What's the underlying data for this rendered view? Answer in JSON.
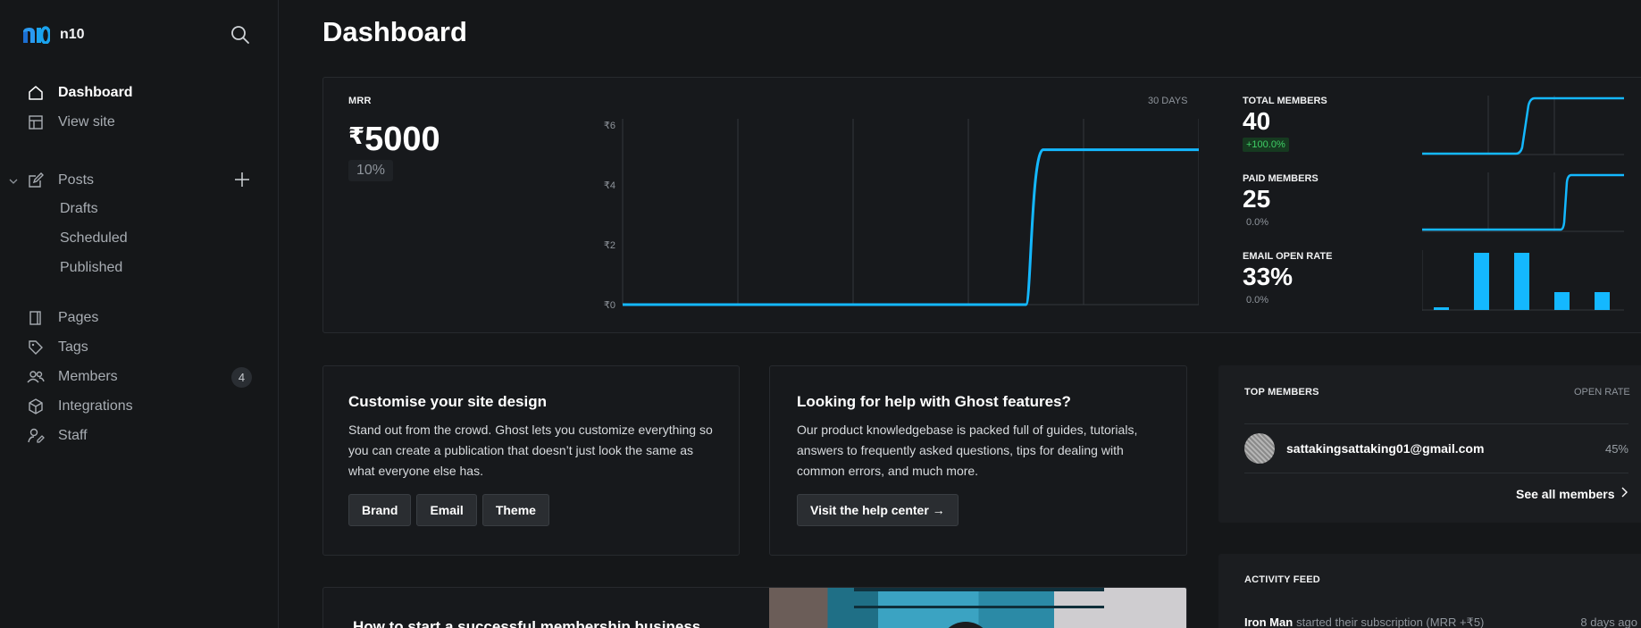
{
  "brand": {
    "name": "n10"
  },
  "sidebar": {
    "items": [
      {
        "label": "Dashboard",
        "icon": "home-icon"
      },
      {
        "label": "View site",
        "icon": "layout-icon"
      },
      {
        "label": "Posts",
        "icon": "edit-icon"
      },
      {
        "label": "Pages",
        "icon": "page-icon"
      },
      {
        "label": "Tags",
        "icon": "tag-icon"
      },
      {
        "label": "Members",
        "icon": "members-icon",
        "badge": "4"
      },
      {
        "label": "Integrations",
        "icon": "cube-icon"
      },
      {
        "label": "Staff",
        "icon": "staff-icon"
      }
    ],
    "posts_sub": [
      "Drafts",
      "Scheduled",
      "Published"
    ]
  },
  "main": {
    "title": "Dashboard"
  },
  "mrr": {
    "label": "MRR",
    "currency": "₹",
    "value": "5000",
    "change": "10%",
    "range": "30 DAYS"
  },
  "stats": [
    {
      "label": "TOTAL MEMBERS",
      "value": "40",
      "delta": "+100.0%"
    },
    {
      "label": "PAID MEMBERS",
      "value": "25",
      "delta": "0.0%"
    },
    {
      "label": "EMAIL OPEN RATE",
      "value": "33%",
      "delta": "0.0%"
    }
  ],
  "chart_data": {
    "type": "line",
    "x": [
      0,
      1,
      2,
      3,
      4,
      5
    ],
    "values": [
      0,
      0,
      0,
      0,
      5,
      5
    ],
    "tick_labels": [
      "₹0",
      "₹2",
      "₹4",
      "₹6"
    ],
    "ylim": [
      0,
      6
    ],
    "grid": true,
    "color": "#14b8ff"
  },
  "info_cards": [
    {
      "title": "Customise your site design",
      "body": "Stand out from the crowd. Ghost lets you customize everything so you can create a publication that doesn’t just look the same as what everyone else has.",
      "buttons": [
        "Brand",
        "Email",
        "Theme"
      ]
    },
    {
      "title": "Looking for help with Ghost features?",
      "body": "Our product knowledgebase is packed full of guides, tutorials, answers to frequently asked questions, tips for dealing with common errors, and much more.",
      "buttons": [
        "Visit the help center →"
      ]
    }
  ],
  "top_members": {
    "title": "TOP MEMBERS",
    "col": "OPEN RATE",
    "rows": [
      {
        "email": "sattakingsattaking01@gmail.com",
        "rate": "45%"
      }
    ],
    "see_all": "See all members"
  },
  "article": {
    "title": "How to start a successful membership business"
  },
  "activity": {
    "title": "ACTIVITY FEED",
    "items": [
      {
        "name": "Iron Man",
        "text": "started their subscription (MRR +₹5)",
        "time": "8 days ago"
      }
    ]
  },
  "colors": {
    "accent": "#14b8ff",
    "background": "#151719",
    "card": "#17191c"
  }
}
